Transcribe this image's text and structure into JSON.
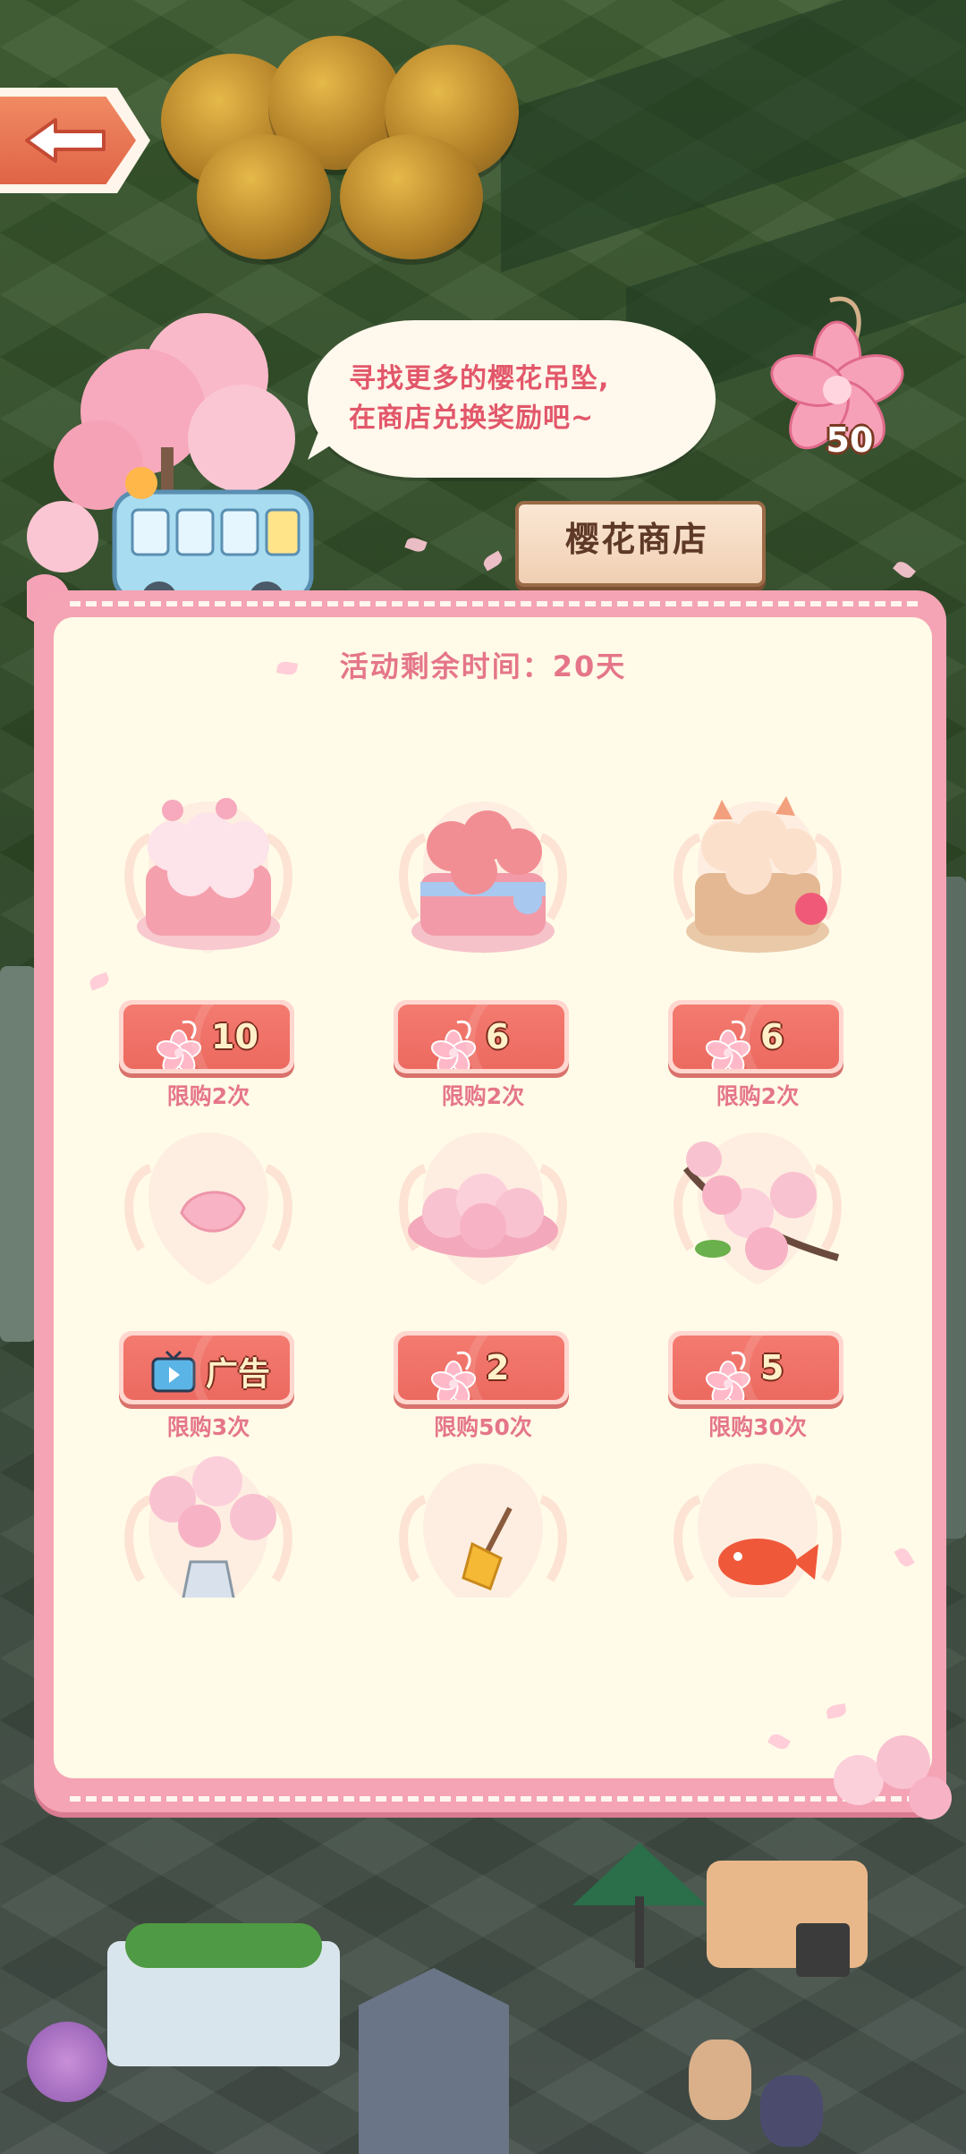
{
  "speech_bubble": {
    "line1": "寻找更多的樱花吊坠,",
    "line2": "在商店兑换奖励吧~"
  },
  "currency": {
    "icon": "sakura-pendant-icon",
    "count": "50"
  },
  "shop": {
    "title": "樱花商店",
    "timer": "活动剩余时间：20天"
  },
  "items": [
    {
      "name": "pink-cat-basket",
      "price": "10",
      "currency": "sakura-pendant-icon",
      "limit": "限购2次"
    },
    {
      "name": "blue-ribbon-fox-basket",
      "price": "6",
      "currency": "sakura-pendant-icon",
      "limit": "限购2次"
    },
    {
      "name": "wicker-fox-basket",
      "price": "6",
      "currency": "sakura-pendant-icon",
      "limit": "限购2次"
    },
    {
      "name": "single-petal",
      "price": "广告",
      "currency": "tv-icon",
      "limit": "限购3次"
    },
    {
      "name": "sakura-pile",
      "price": "2",
      "currency": "sakura-pendant-icon",
      "limit": "限购50次"
    },
    {
      "name": "sakura-branch",
      "price": "5",
      "currency": "sakura-pendant-icon",
      "limit": "限购30次"
    },
    {
      "name": "sakura-vase"
    },
    {
      "name": "broom"
    },
    {
      "name": "red-fish"
    }
  ],
  "colors": {
    "panel_border": "#f4a4b4",
    "panel_bg": "#fffbe8",
    "accent_text": "#e5768a",
    "price_button": "#ec6a60"
  }
}
